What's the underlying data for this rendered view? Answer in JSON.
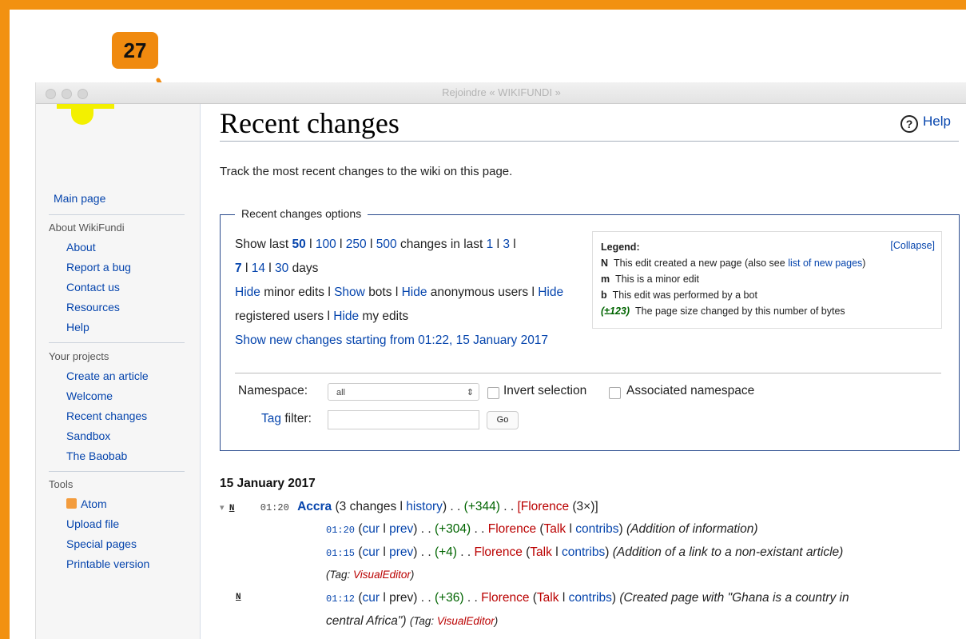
{
  "annotation": {
    "step_number": "27",
    "color": "#f08a0f"
  },
  "window": {
    "title": "Rejoindre « WIKIFUNDI »"
  },
  "sidebar": {
    "main_page": "Main page",
    "about_heading": "About WikiFundi",
    "about_items": [
      "About",
      "Report a bug",
      "Contact us",
      "Resources",
      "Help"
    ],
    "projects_heading": "Your projects",
    "projects_items": [
      "Create an article",
      "Welcome",
      "Recent changes",
      "Sandbox",
      "The Baobab"
    ],
    "tools_heading": "Tools",
    "tools_items": [
      "Atom",
      "Upload file",
      "Special pages",
      "Printable version"
    ]
  },
  "page": {
    "title": "Recent changes",
    "help_label": "Help",
    "intro": "Track the most recent changes to the wiki on this page."
  },
  "options": {
    "legend_title": "Recent changes options",
    "show_last": "Show last",
    "limits": [
      "50",
      "100",
      "250",
      "500"
    ],
    "changes_in_last": "changes in last",
    "days_options": [
      "1",
      "3",
      "7",
      "14",
      "30"
    ],
    "days": "days",
    "sep": "l",
    "hide": "Hide",
    "show": "Show",
    "minor_edits": "minor edits",
    "bots": "bots",
    "anonymous_users": "anonymous users",
    "registered_users": "registered users",
    "my_edits": "my edits",
    "new_changes_link": "Show new changes starting from 01:22, 15 January 2017",
    "namespace_label": "Namespace:",
    "namespace_value": "all",
    "invert_selection": "Invert selection",
    "associated_namespace": "Associated namespace",
    "tag_filter_link": "Tag",
    "tag_filter_rest": "filter:",
    "go_button": "Go"
  },
  "legend": {
    "title": "Legend:",
    "collapse": "[Collapse]",
    "n_flag": "N",
    "n_text": "This edit created a new page (also see",
    "n_link": "list of new pages",
    "n_close": ")",
    "m_flag": "m",
    "m_text": "This is a minor edit",
    "b_flag": "b",
    "b_text": "This edit was performed by a bot",
    "size_flag": "(±123)",
    "size_text": "The page size changed by this number of bytes"
  },
  "changes": {
    "date": "15 January 2017",
    "group": {
      "toggle": "▾",
      "flag": "N",
      "time": "01:20",
      "page": "Accra",
      "count": "(3 changes",
      "history": "history",
      "close": ")",
      "dots": ". .",
      "size": "(+344)",
      "user_open": "[",
      "user": "Florence",
      "user_count": "(3×)]"
    },
    "entries": [
      {
        "time": "01:20",
        "cur": "cur",
        "prev": "prev",
        "size": "(+304)",
        "user": "Florence",
        "talk": "Talk",
        "contribs": "contribs",
        "summary": "(Addition of information)"
      },
      {
        "time": "01:15",
        "cur": "cur",
        "prev": "prev",
        "size": "(+4)",
        "user": "Florence",
        "talk": "Talk",
        "contribs": "contribs",
        "summary": "(Addition of a link to a non-existant article)",
        "tag_label": "(Tag:",
        "tag": "VisualEditor",
        "tag_close": ")"
      },
      {
        "flag": "N",
        "time": "01:12",
        "cur": "cur",
        "prev": "prev",
        "size": "(+36)",
        "user": "Florence",
        "talk": "Talk",
        "contribs": "contribs",
        "summary_1": "(Created page with \"Ghana is a country in",
        "summary_2": "central Africa\")",
        "tag_label": "(Tag:",
        "tag": "VisualEditor",
        "tag_close": ")"
      }
    ]
  }
}
